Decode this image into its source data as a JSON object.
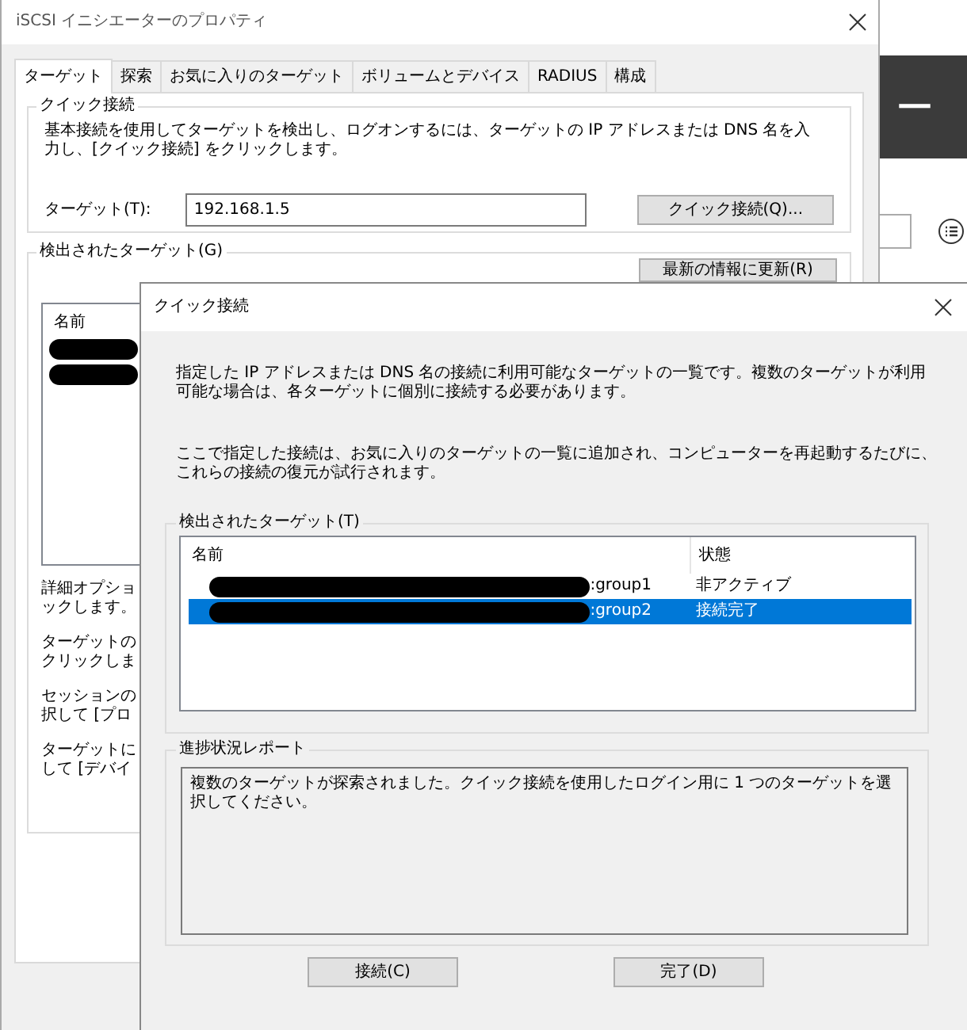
{
  "main_window": {
    "title": "iSCSI イニシエーターのプロパティ",
    "tabs": [
      {
        "label": "ターゲット",
        "selected": true
      },
      {
        "label": "探索",
        "selected": false
      },
      {
        "label": "お気に入りのターゲット",
        "selected": false
      },
      {
        "label": "ボリュームとデバイス",
        "selected": false
      },
      {
        "label": "RADIUS",
        "selected": false
      },
      {
        "label": "構成",
        "selected": false
      }
    ],
    "quick_connect_group": {
      "label": "クイック接続",
      "description": "基本接続を使用してターゲットを検出し、ログオンするには、ターゲットの IP アドレスまたは DNS 名を入力し、[クイック接続] をクリックします。",
      "target_label": "ターゲット(T):",
      "target_value": "192.168.1.5",
      "button": "クイック接続(Q)..."
    },
    "discovered_group": {
      "label": "検出されたターゲット(G)",
      "refresh_button": "最新の情報に更新(R)",
      "list_header": "名前",
      "hints": [
        [
          "詳細オプショ",
          "ックします。"
        ],
        [
          "ターゲットの",
          "クリックしま"
        ],
        [
          "セッションの",
          "択して [プロ"
        ],
        [
          "ターゲットに",
          "して [デバイ"
        ]
      ]
    }
  },
  "background_window": {
    "heading": "ー"
  },
  "dialog": {
    "title": "クイック接続",
    "paragraphs": [
      "指定した IP アドレスまたは DNS 名の接続に利用可能なターゲットの一覧です。複数のターゲットが利用可能な場合は、各ターゲットに個別に接続する必要があります。",
      "ここで指定した接続は、お気に入りのターゲットの一覧に追加され、コンピューターを再起動するたびに、これらの接続の復元が試行されます。"
    ],
    "targets_group": {
      "label": "検出されたターゲット(T)",
      "columns": [
        "名前",
        "状態"
      ],
      "rows": [
        {
          "name": ":group1",
          "status": "非アクティブ",
          "selected": false
        },
        {
          "name": ":group2",
          "status": "接続完了",
          "selected": true
        }
      ]
    },
    "progress_group": {
      "label": "進捗状況レポート",
      "message": "複数のターゲットが探索されました。クイック接続を使用したログイン用に 1 つのターゲットを選択してください。"
    },
    "buttons": [
      "接続(C)",
      "完了(D)"
    ]
  }
}
